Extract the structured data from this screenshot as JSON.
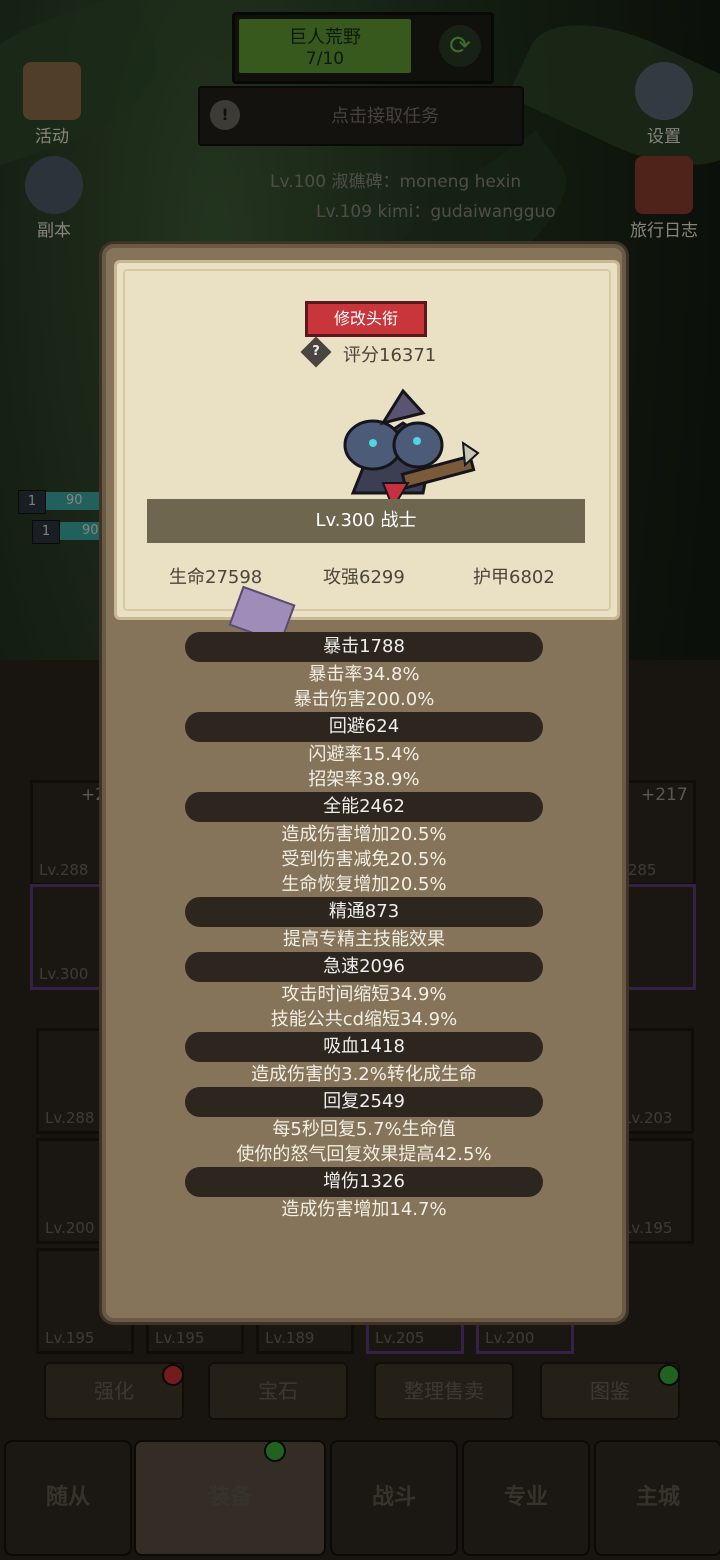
{
  "top": {
    "zone_name": "巨人荒野",
    "zone_progress": "7/10",
    "task_label": "点击接取任务"
  },
  "side_buttons": {
    "activity": "活动",
    "dungeon": "副本",
    "settings": "设置",
    "travel_log": "旅行日志"
  },
  "leaderboard": [
    "Lv.100 淑礁碑：moneng hexin",
    "Lv.109 kimi：gudaiwangguo"
  ],
  "background_ui": {
    "party_level": "1",
    "party_hp": "90",
    "gear_levels": [
      "Lv.288",
      "Lv.285",
      "Lv.300",
      "Lv.288",
      "Lv.203",
      "Lv.200",
      "Lv.195",
      "Lv.195",
      "Lv.195",
      "Lv.189",
      "Lv.205",
      "Lv.200"
    ],
    "gear_bonus_left": "+2",
    "gear_bonus_right": "+217",
    "actions": [
      "强化",
      "宝石",
      "整理售卖",
      "图鉴"
    ],
    "nav": [
      "随从",
      "装备",
      "战斗",
      "专业",
      "主城"
    ]
  },
  "profile": {
    "change_title_label": "修改头衔",
    "help_icon": "?",
    "score_label": "评分16371",
    "name_label": "Lv.300 战士",
    "base_stats": [
      "生命27598",
      "攻强6299",
      "护甲6802"
    ],
    "stats": [
      {
        "head": "暴击1788",
        "lines": [
          "暴击率34.8%",
          "暴击伤害200.0%"
        ]
      },
      {
        "head": "回避624",
        "lines": [
          "闪避率15.4%",
          "招架率38.9%"
        ]
      },
      {
        "head": "全能2462",
        "lines": [
          "造成伤害增加20.5%",
          "受到伤害减免20.5%",
          "生命恢复增加20.5%"
        ]
      },
      {
        "head": "精通873",
        "lines": [
          "提高专精主技能效果"
        ]
      },
      {
        "head": "急速2096",
        "lines": [
          "攻击时间缩短34.9%",
          "技能公共cd缩短34.9%"
        ]
      },
      {
        "head": "吸血1418",
        "lines": [
          "造成伤害的3.2%转化成生命"
        ]
      },
      {
        "head": "回复2549",
        "lines": [
          "每5秒回复5.7%生命值",
          "使你的怒气回复效果提高42.5%"
        ]
      },
      {
        "head": "增伤1326",
        "lines": [
          "造成伤害增加14.7%"
        ]
      }
    ]
  },
  "colors": {
    "zone_bar": "#5f9a33",
    "title_button": "#c8353a",
    "modal_bg": "#85745a",
    "card_bg": "#eae0c4",
    "stat_head_bg": "#2d261e"
  }
}
